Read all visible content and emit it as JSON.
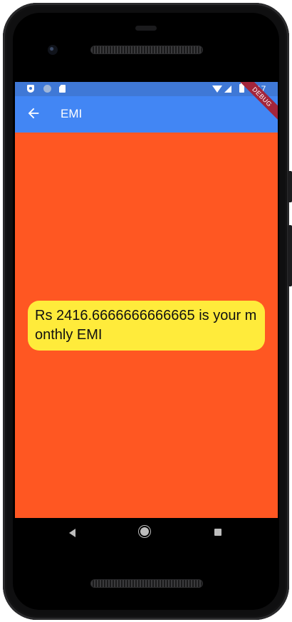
{
  "status_bar": {
    "time": "4:17"
  },
  "app_bar": {
    "title": "EMI"
  },
  "debug_banner": {
    "label": "DEBUG"
  },
  "result": {
    "message": "Rs 2416.6666666666665 is your monthly EMI"
  },
  "colors": {
    "app_bar": "#4286f4",
    "status_bar": "#3f78d6",
    "background": "#ff5722",
    "card": "#ffeb3b",
    "debug_banner": "#a3253b"
  }
}
